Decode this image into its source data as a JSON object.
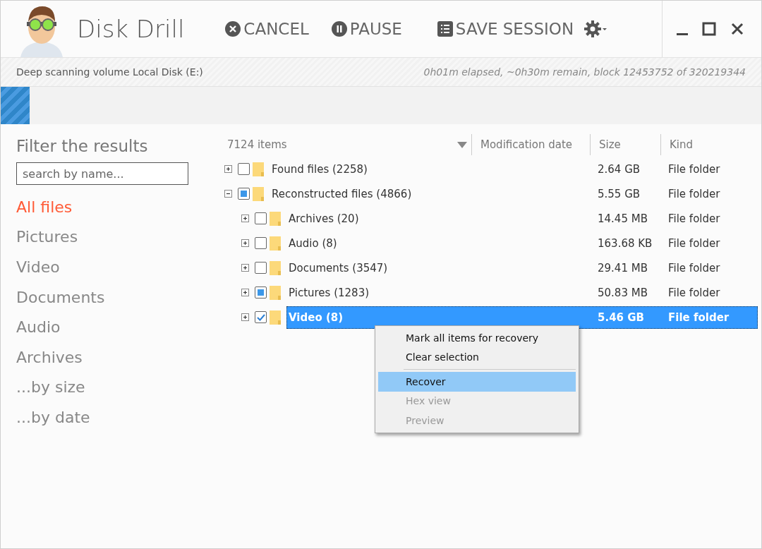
{
  "window": {
    "title": "Disk Drill"
  },
  "toolbar": [
    {
      "label": "CANCEL",
      "kind": "cancel"
    },
    {
      "label": "PAUSE",
      "kind": "pause"
    },
    {
      "label": "SAVE SESSION",
      "kind": "save"
    }
  ],
  "status_bar": {
    "message": "Deep scanning volume Local Disk (E:)",
    "progress_text": "0h01m elapsed, ~0h30m remain, block 12453752 of 320219344"
  },
  "progress": {
    "level": 0.038
  },
  "sidebar": {
    "title": "Filter the results",
    "search": {
      "placeholder": "search by name..."
    },
    "items": [
      {
        "label": "All files",
        "selected": true
      },
      {
        "label": "Pictures",
        "selected": false
      },
      {
        "label": "Video",
        "selected": false
      },
      {
        "label": "Documents",
        "selected": false
      },
      {
        "label": "Audio",
        "selected": false
      },
      {
        "label": "Archives",
        "selected": false
      },
      {
        "label": "...by size",
        "selected": false
      },
      {
        "label": "...by date",
        "selected": false
      }
    ]
  },
  "table": {
    "columns": [
      "7124 items",
      "Modification date",
      "Size",
      "Kind"
    ],
    "rows": [
      {
        "name": "Found files (2258)",
        "size": "2.64 GB",
        "kind": "File folder",
        "checked": false,
        "partial": false,
        "expanded": false,
        "selected": false
      },
      {
        "name": "Reconstructed files (4866)",
        "size": "5.55 GB",
        "kind": "File folder",
        "checked": false,
        "partial": true,
        "expanded": true,
        "selected": false,
        "children": [
          {
            "name": "Archives (20)",
            "size": "14.45 MB",
            "kind": "File folder",
            "checked": false,
            "partial": false,
            "expanded": false,
            "selected": false
          },
          {
            "name": "Audio (8)",
            "size": "163.68 KB",
            "kind": "File folder",
            "checked": false,
            "partial": false,
            "expanded": false,
            "selected": false
          },
          {
            "name": "Documents (3547)",
            "size": "29.41 MB",
            "kind": "File folder",
            "checked": false,
            "partial": false,
            "expanded": false,
            "selected": false
          },
          {
            "name": "Pictures (1283)",
            "size": "50.83 MB",
            "kind": "File folder",
            "checked": false,
            "partial": true,
            "expanded": false,
            "selected": false
          },
          {
            "name": "Video (8)",
            "size": "5.46 GB",
            "kind": "File folder",
            "checked": true,
            "partial": false,
            "expanded": false,
            "selected": true
          }
        ]
      }
    ]
  },
  "context_menu": {
    "groups": [
      [
        {
          "label": "Mark all items for recovery",
          "disabled": false,
          "selected": false
        },
        {
          "label": "Clear selection",
          "disabled": false,
          "selected": false
        }
      ],
      [
        {
          "label": "Recover",
          "disabled": false,
          "selected": true
        },
        {
          "label": "Hex view",
          "disabled": true,
          "selected": false
        },
        {
          "label": "Preview",
          "disabled": true,
          "selected": false
        }
      ]
    ]
  }
}
